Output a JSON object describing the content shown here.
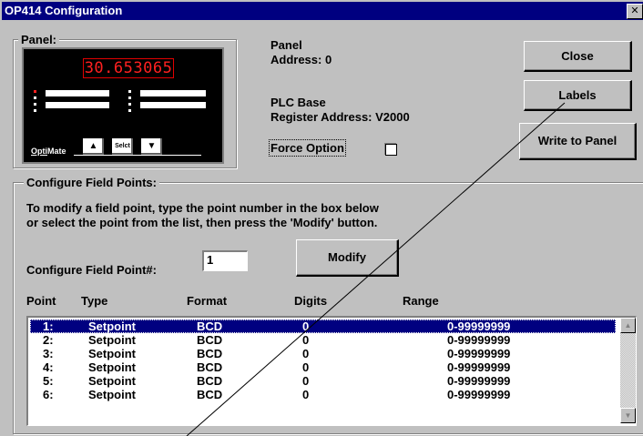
{
  "window": {
    "title": "OP414 Configuration",
    "close_glyph": "✕"
  },
  "panel_group": {
    "label": "Panel:"
  },
  "display": {
    "value": "30.653065",
    "brand_opti": "Opti",
    "brand_mate": "Mate",
    "keys": {
      "up": "▲",
      "select": "Selct",
      "down": "▼"
    }
  },
  "panel_info": {
    "panel_address_label": "Panel",
    "panel_address_value": "Address: 0",
    "plc_base_label": "PLC Base",
    "register_address": "Register Address: V2000",
    "force_option_label": "Force Option",
    "force_option_checked": false
  },
  "buttons": {
    "close": "Close",
    "labels": "Labels",
    "write_to_panel": "Write to Panel",
    "modify": "Modify"
  },
  "field_points": {
    "group_label": "Configure Field Points:",
    "instructions_line1": "To modify a field point, type the point number in the box below",
    "instructions_line2": "or select the point from the list, then press the 'Modify' button.",
    "point_input_label": "Configure Field Point#:",
    "point_input_value": "1",
    "columns": [
      "Point",
      "Type",
      "Format",
      "Digits",
      "Range"
    ],
    "rows": [
      [
        "1:",
        "Setpoint",
        "BCD",
        "0",
        "0-99999999"
      ],
      [
        "2:",
        "Setpoint",
        "BCD",
        "0",
        "0-99999999"
      ],
      [
        "3:",
        "Setpoint",
        "BCD",
        "0",
        "0-99999999"
      ],
      [
        "4:",
        "Setpoint",
        "BCD",
        "0",
        "0-99999999"
      ],
      [
        "5:",
        "Setpoint",
        "BCD",
        "0",
        "0-99999999"
      ],
      [
        "6:",
        "Setpoint",
        "BCD",
        "0",
        "0-99999999"
      ]
    ],
    "selected_row": 0
  },
  "scrollbar": {
    "up_glyph": "▲",
    "down_glyph": "▼"
  },
  "colors": {
    "title_bar": "#000080",
    "face": "#c0c0c0",
    "selection": "#000080",
    "lcd_red": "#ff2020"
  }
}
